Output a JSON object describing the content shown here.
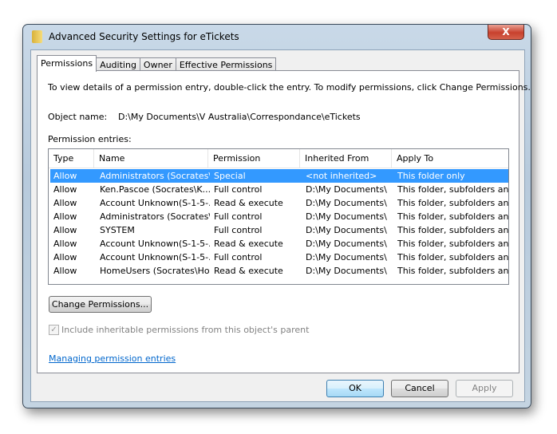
{
  "window": {
    "title": "Advanced Security Settings for eTickets",
    "close_label": "X"
  },
  "tabs": [
    {
      "label": "Permissions"
    },
    {
      "label": "Auditing"
    },
    {
      "label": "Owner"
    },
    {
      "label": "Effective Permissions"
    }
  ],
  "instructions": "To view details of a permission entry, double-click the entry. To modify permissions, click Change Permissions.",
  "object": {
    "label": "Object name:",
    "value": "D:\\My Documents\\V Australia\\Correspondance\\eTickets"
  },
  "entries_label": "Permission entries:",
  "columns": [
    "Type",
    "Name",
    "Permission",
    "Inherited From",
    "Apply To"
  ],
  "rows": [
    [
      "Allow",
      "Administrators (Socrates\\...",
      "Special",
      "<not inherited>",
      "This folder only"
    ],
    [
      "Allow",
      "Ken.Pascoe (Socrates\\K...",
      "Full control",
      "D:\\My Documents\\",
      "This folder, subfolders and..."
    ],
    [
      "Allow",
      "Account Unknown(S-1-5-...",
      "Read & execute",
      "D:\\My Documents\\",
      "This folder, subfolders and..."
    ],
    [
      "Allow",
      "Administrators (Socrates\\...",
      "Full control",
      "D:\\My Documents\\",
      "This folder, subfolders and..."
    ],
    [
      "Allow",
      "SYSTEM",
      "Full control",
      "D:\\My Documents\\",
      "This folder, subfolders and..."
    ],
    [
      "Allow",
      "Account Unknown(S-1-5-...",
      "Read & execute",
      "D:\\My Documents\\",
      "This folder, subfolders and..."
    ],
    [
      "Allow",
      "Account Unknown(S-1-5-...",
      "Full control",
      "D:\\My Documents\\",
      "This folder, subfolders and..."
    ],
    [
      "Allow",
      "HomeUsers (Socrates\\Ho...",
      "Read & execute",
      "D:\\My Documents\\",
      "This folder, subfolders and..."
    ]
  ],
  "selected_row": 0,
  "change_button": "Change Permissions...",
  "inherit_checkbox": {
    "label": "Include inheritable permissions from this object's parent",
    "checked": true,
    "disabled": true
  },
  "help_link": "Managing permission entries",
  "buttons": {
    "ok": "OK",
    "cancel": "Cancel",
    "apply": "Apply"
  },
  "colors": {
    "selection": "#3399ff",
    "link": "#0066cc",
    "close": "#c8412e"
  }
}
